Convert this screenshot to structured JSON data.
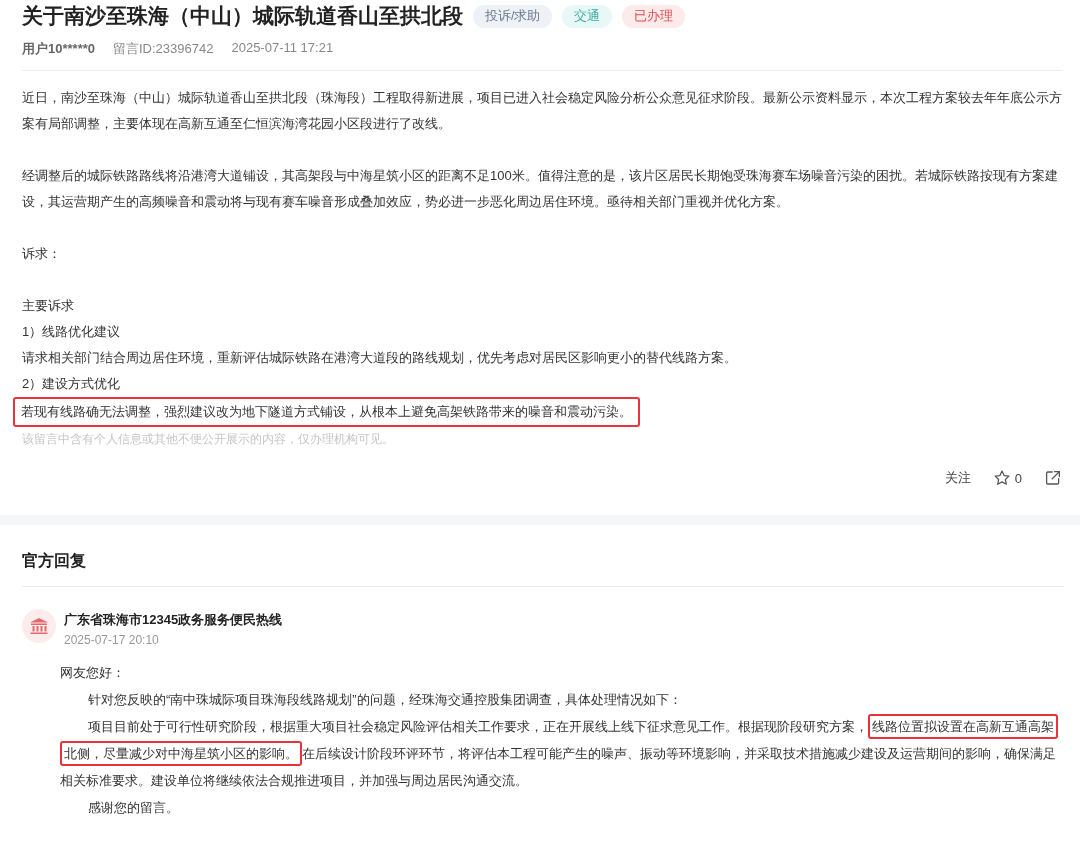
{
  "title": "关于南沙至珠海（中山）城际轨道香山至拱北段",
  "tags": [
    {
      "label": "投诉/求助",
      "color": "#eef1f6"
    },
    {
      "label": "交通",
      "color": "#e8f8f7"
    },
    {
      "label": "已办理",
      "color": "#fdeaea"
    }
  ],
  "meta": {
    "user": "用户10*****0",
    "message_id": "留言ID:23396742",
    "time": "2025-07-11 17:21"
  },
  "body": [
    {
      "kind": "paragraph",
      "highlighted": false,
      "text": "近日，南沙至珠海（中山）城际轨道香山至拱北段（珠海段）工程取得新进展，项目已进入社会稳定风险分析公众意见征求阶段。最新公示资料显示，本次工程方案较去年年底公示方案有局部调整，主要体现在高新互通至仁恒滨海湾花园小区段进行了改线。"
    },
    {
      "kind": "paragraph",
      "highlighted": false,
      "text": "经调整后的城际铁路路线将沿港湾大道铺设，其高架段与中海星筑小区的距离不足100米。值得注意的是，该片区居民长期饱受珠海赛车场噪音污染的困扰。若城际铁路按现有方案建设，其运营期产生的高频噪音和震动将与现有赛车噪音形成叠加效应，势必进一步恶化周边居住环境。亟待相关部门重视并优化方案。"
    },
    {
      "kind": "paragraph",
      "highlighted": false,
      "text": "诉求："
    },
    {
      "kind": "line",
      "highlighted": false,
      "text": "主要诉求"
    },
    {
      "kind": "line",
      "highlighted": false,
      "text": "1）线路优化建议"
    },
    {
      "kind": "line",
      "highlighted": false,
      "text": "请求相关部门结合周边居住环境，重新评估城际铁路在港湾大道段的路线规划，优先考虑对居民区影响更小的替代线路方案。"
    },
    {
      "kind": "line",
      "highlighted": false,
      "text": "2）建设方式优化"
    },
    {
      "kind": "line",
      "highlighted": true,
      "text": "若现有线路确无法调整，强烈建议改为地下隧道方式铺设，从根本上避免高架铁路带来的噪音和震动污染。"
    }
  ],
  "privacy_note": "该留言中含有个人信息或其他不便公开展示的内容，仅办理机构可见。",
  "actions": {
    "follow": "关注",
    "star_count": "0"
  },
  "reply": {
    "heading": "官方回复",
    "agency": "广东省珠海市12345政务服务便民热线",
    "time": "2025-07-17 20:10",
    "greeting": "网友您好：",
    "paragraphs": [
      [
        {
          "text": "针对您反映的“南中珠城际项目珠海段线路规划”的问题，经珠海交通控股集团调查，具体处理情况如下：",
          "highlighted": false
        }
      ],
      [
        {
          "text": "项目目前处于可行性研究阶段，根据重大项目社会稳定风险评估相关工作要求，正在开展线上线下征求意见工作。根据现阶段研究方案，",
          "highlighted": false
        },
        {
          "text": "线路位置拟设置在高新互通高架北侧，尽量减少对中海星筑小区的影响。",
          "highlighted": true
        },
        {
          "text": "在后续设计阶段环评环节，将评估本工程可能产生的噪声、振动等环境影响，并采取技术措施减少建设及运营期间的影响，确保满足相关标准要求。建设单位将继续依法合规推进项目，并加强与周边居民沟通交流。",
          "highlighted": false
        }
      ],
      [
        {
          "text": "感谢您的留言。",
          "highlighted": false
        }
      ]
    ]
  }
}
